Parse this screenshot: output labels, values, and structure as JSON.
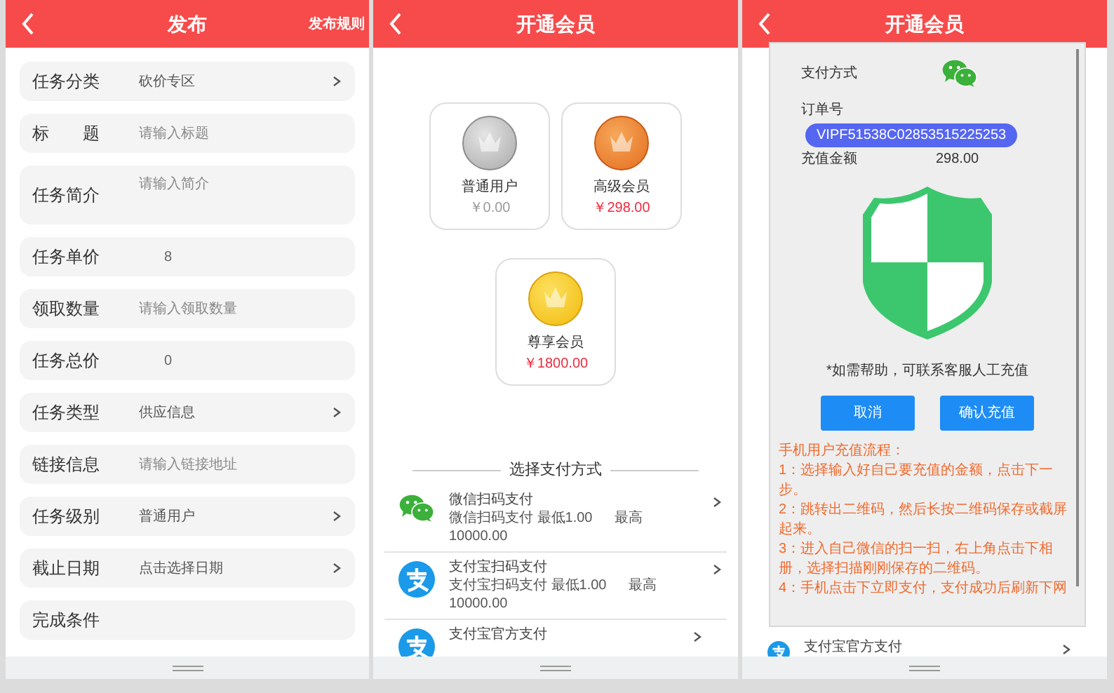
{
  "publish_screen": {
    "title": "发布",
    "rules_link": "发布规则",
    "fields": [
      {
        "label": "任务分类",
        "value": "砍价专区",
        "kind": "select"
      },
      {
        "label": "标　　题",
        "placeholder": "请输入标题",
        "kind": "input"
      },
      {
        "label": "任务简介",
        "placeholder": "请输入简介",
        "kind": "textarea"
      },
      {
        "label": "任务单价",
        "value": "8",
        "kind": "readonly"
      },
      {
        "label": "领取数量",
        "placeholder": "请输入领取数量",
        "kind": "input"
      },
      {
        "label": "任务总价",
        "value": "0",
        "kind": "readonly"
      },
      {
        "label": "任务类型",
        "value": "供应信息",
        "kind": "select"
      },
      {
        "label": "链接信息",
        "placeholder": "请输入链接地址",
        "kind": "input"
      },
      {
        "label": "任务级别",
        "value": "普通用户",
        "kind": "select"
      },
      {
        "label": "截止日期",
        "value": "点击选择日期",
        "kind": "select"
      },
      {
        "label": "完成条件",
        "kind": "input"
      }
    ]
  },
  "membership_screen": {
    "title": "开通会员",
    "tiers": [
      {
        "name": "普通用户",
        "price": "￥0.00",
        "kind": "silver"
      },
      {
        "name": "高级会员",
        "price": "￥298.00",
        "kind": "bronze"
      },
      {
        "name": "尊享会员",
        "price": "￥1800.00",
        "kind": "gold"
      }
    ],
    "payment_heading": "选择支付方式",
    "payment_methods": [
      {
        "name": "微信扫码支付",
        "detail": "微信扫码支付 最低1.00 　 最高10000.00",
        "kind": "wechat"
      },
      {
        "name": "支付宝扫码支付",
        "detail": "支付宝扫码支付 最低1.00 　 最高10000.00",
        "kind": "alipay"
      },
      {
        "name": "支付宝官方支付",
        "kind": "alipay"
      }
    ]
  },
  "payment_screen": {
    "title": "开通会员",
    "visible_methods": [
      {
        "name": "支付宝官方支付",
        "kind": "alipay"
      }
    ],
    "dialog": {
      "method": {
        "label": "支付方式",
        "kind": "wechat"
      },
      "order_label": "订单号",
      "order_number": "VIPF51538C02853515225253",
      "amount_label": "充值金额",
      "amount": "298.00",
      "help": "*如需帮助，可联系客服人工充值",
      "buttons": [
        "取消",
        "确认充值"
      ],
      "instructions": [
        "手机用户充值流程：",
        "1：选择输入好自己要充值的金额，点击下一步。",
        "2：跳转出二维码，然后长按二维码保存或截屏起来。",
        "3：进入自己微信的扫一扫，右上角点击下相册，选择扫描刚刚保存的二维码。",
        "4：手机点击下立即支付，支付成功后刷新下网"
      ]
    }
  }
}
